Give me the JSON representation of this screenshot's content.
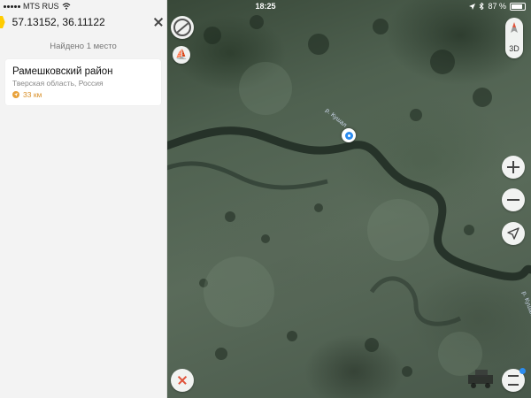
{
  "status_bar": {
    "carrier": "MTS RUS",
    "time": "18:25",
    "battery": "87 %"
  },
  "search": {
    "query": "57.13152, 36.11122"
  },
  "results": {
    "count_label": "Найдено 1 место",
    "items": [
      {
        "title": "Рамешковский район",
        "subtitle": "Тверская область, Россия",
        "distance": "33 км"
      }
    ]
  },
  "map": {
    "river_label_1": "р. Кушал",
    "river_label_2": "р. Кушал",
    "btn_3d": "3D"
  },
  "colors": {
    "accent": "#2b8cf0",
    "brand": "#ffcc00",
    "distance": "#d9902a",
    "cancel": "#e0533a"
  }
}
